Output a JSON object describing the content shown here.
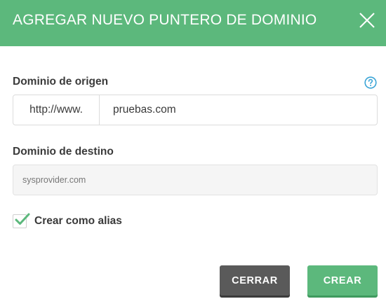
{
  "dialog": {
    "title": "AGREGAR NUEVO PUNTERO DE DOMINIO",
    "close_icon": "close-icon"
  },
  "colors": {
    "header": "#5cb87c",
    "primary_button": "#5cb87c",
    "secondary_button": "#5a5a5a",
    "help_icon": "#3aa4d6",
    "check": "#5cb87c"
  },
  "origin": {
    "label": "Dominio de origen",
    "help_icon": "question-circle-icon",
    "prefix": "http://www.",
    "value": "pruebas.com"
  },
  "destination": {
    "label": "Dominio de destino",
    "value": "sysprovider.com"
  },
  "alias": {
    "label": "Crear como alias",
    "checked": true
  },
  "buttons": {
    "close_label": "CERRAR",
    "create_label": "CREAR"
  }
}
